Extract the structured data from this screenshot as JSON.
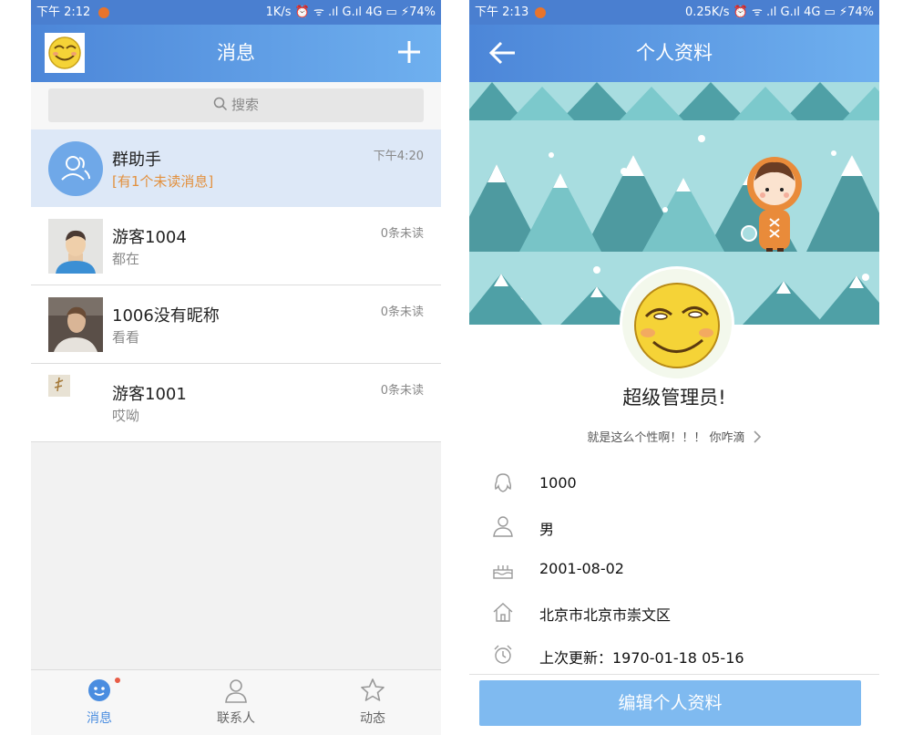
{
  "left": {
    "status": {
      "time": "下午 2:12",
      "right": "1K/s ⏰ ᯤ .ıl G.ıl 4G ▭ ⚡74%"
    },
    "title": "消息",
    "search_placeholder": "搜索",
    "conversations": [
      {
        "name": "群助手",
        "preview": "[有1个未读消息]",
        "meta": "下午4:20"
      },
      {
        "name": "游客1004",
        "preview": "都在",
        "meta": "0条未读"
      },
      {
        "name": "1006没有昵称",
        "preview": "看看",
        "meta": "0条未读"
      },
      {
        "name": "游客1001",
        "preview": "哎呦",
        "meta": "0条未读"
      }
    ],
    "tabs": [
      {
        "label": "消息",
        "active": true
      },
      {
        "label": "联系人",
        "active": false
      },
      {
        "label": "动态",
        "active": false
      }
    ]
  },
  "right": {
    "status": {
      "time": "下午 2:13",
      "right": "0.25K/s ⏰ ᯤ .ıl G.ıl 4G ▭ ⚡74%"
    },
    "title": "个人资料",
    "nickname": "超级管理员!",
    "signature": "就是这么个性啊！！！ 你咋滴",
    "info": [
      {
        "icon": "qq-penguin-icon",
        "value": "1000"
      },
      {
        "icon": "person-icon",
        "value": "男"
      },
      {
        "icon": "cake-icon",
        "value": "2001-08-02"
      },
      {
        "icon": "home-icon",
        "value": "北京市北京市崇文区"
      },
      {
        "icon": "alarm-clock-icon",
        "value": "上次更新：1970-01-18 05-16"
      }
    ],
    "edit_button": "编辑个人资料"
  },
  "colors": {
    "primary": "#4a7fd0",
    "accent_light": "#7fbaf0",
    "unread": "#e2903d",
    "highlight_row": "#dde8f7"
  }
}
